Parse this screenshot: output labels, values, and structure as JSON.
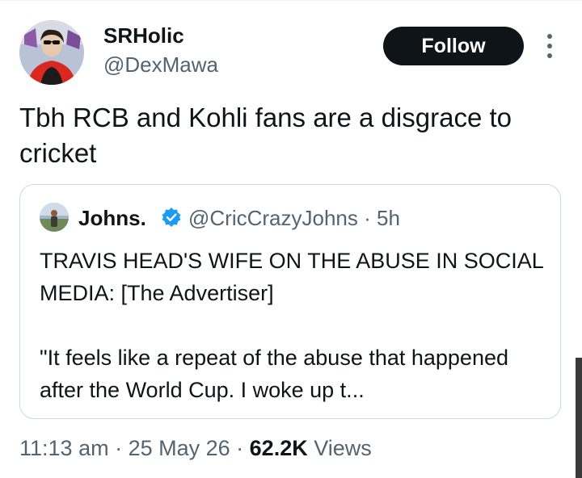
{
  "author": {
    "display_name": "SRHolic",
    "handle": "@DexMawa"
  },
  "follow_button": {
    "label": "Follow"
  },
  "more_icon": "more-vertical-icon",
  "tweet": {
    "text": "Tbh RCB and Kohli fans are a disgrace to cricket"
  },
  "quoted_tweet": {
    "display_name": "Johns.",
    "verified": true,
    "meta": "@CricCrazyJohns · 5h",
    "paragraph_1": "TRAVIS HEAD'S WIFE ON THE ABUSE IN SOCIAL MEDIA: [The Advertiser]",
    "paragraph_2": "\"It feels like a repeat of the abuse that happened after the World Cup. I woke up t..."
  },
  "tweet_meta": {
    "time_date": "11:13 am · 25 May 26 ·",
    "views_count": "62.2K",
    "views_label": "Views"
  },
  "colors": {
    "text": "#0f1419",
    "secondary": "#536471",
    "follow_bg": "#0f1419",
    "verified": "#1d9bf0",
    "border": "#cfd9de"
  }
}
